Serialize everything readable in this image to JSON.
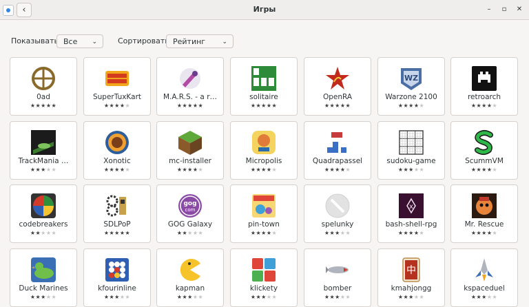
{
  "window": {
    "title": "Игры",
    "back_glyph": "‹",
    "minimize_glyph": "–",
    "maximize_glyph": "▫",
    "close_glyph": "✕"
  },
  "filters": {
    "show_label": "Показывать",
    "show_value": "Все",
    "sort_label": "Сортировать",
    "sort_value": "Рейтинг",
    "chevron": "⌄"
  },
  "games": [
    {
      "name": "0ad",
      "rating": 5,
      "icon": "0ad-icon"
    },
    {
      "name": "SuperTuxKart",
      "rating": 4,
      "icon": "supertuxkart-icon"
    },
    {
      "name": "M.A.R.S. - a r…",
      "rating": 5,
      "icon": "mars-icon"
    },
    {
      "name": "solitaire",
      "rating": 5,
      "icon": "solitaire-icon"
    },
    {
      "name": "OpenRA",
      "rating": 5,
      "icon": "openra-icon"
    },
    {
      "name": "Warzone 2100",
      "rating": 4,
      "icon": "warzone-icon"
    },
    {
      "name": "retroarch",
      "rating": 4,
      "icon": "retroarch-icon"
    },
    {
      "name": "TrackMania …",
      "rating": 3,
      "icon": "trackmania-icon"
    },
    {
      "name": "Xonotic",
      "rating": 4,
      "icon": "xonotic-icon"
    },
    {
      "name": "mc-installer",
      "rating": 4,
      "icon": "minecraft-icon"
    },
    {
      "name": "Micropolis",
      "rating": 4,
      "icon": "micropolis-icon"
    },
    {
      "name": "Quadrapassel",
      "rating": 4,
      "icon": "quadrapassel-icon"
    },
    {
      "name": "sudoku-game",
      "rating": 3,
      "icon": "sudoku-icon"
    },
    {
      "name": "ScummVM",
      "rating": 4,
      "icon": "scummvm-icon"
    },
    {
      "name": "codebreakers",
      "rating": 2,
      "icon": "codebreakers-icon"
    },
    {
      "name": "SDLPoP",
      "rating": 5,
      "icon": "sdlpop-icon"
    },
    {
      "name": "GOG Galaxy",
      "rating": 2,
      "icon": "gog-icon"
    },
    {
      "name": "pin-town",
      "rating": 4,
      "icon": "pintown-icon"
    },
    {
      "name": "spelunky",
      "rating": 3,
      "icon": "spelunky-icon"
    },
    {
      "name": "bash-shell-rpg",
      "rating": 4,
      "icon": "bash-rpg-icon"
    },
    {
      "name": "Mr. Rescue",
      "rating": 4,
      "icon": "mrrescue-icon"
    },
    {
      "name": "Duck Marines",
      "rating": 3,
      "icon": "duck-marines-icon"
    },
    {
      "name": "kfourinline",
      "rating": 3,
      "icon": "kfourinline-icon"
    },
    {
      "name": "kapman",
      "rating": 3,
      "icon": "kapman-icon"
    },
    {
      "name": "klickety",
      "rating": 3,
      "icon": "klickety-icon"
    },
    {
      "name": "bomber",
      "rating": 3,
      "icon": "bomber-icon"
    },
    {
      "name": "kmahjongg",
      "rating": 3,
      "icon": "kmahjongg-icon"
    },
    {
      "name": "kspaceduel",
      "rating": 3,
      "icon": "kspaceduel-icon"
    }
  ]
}
